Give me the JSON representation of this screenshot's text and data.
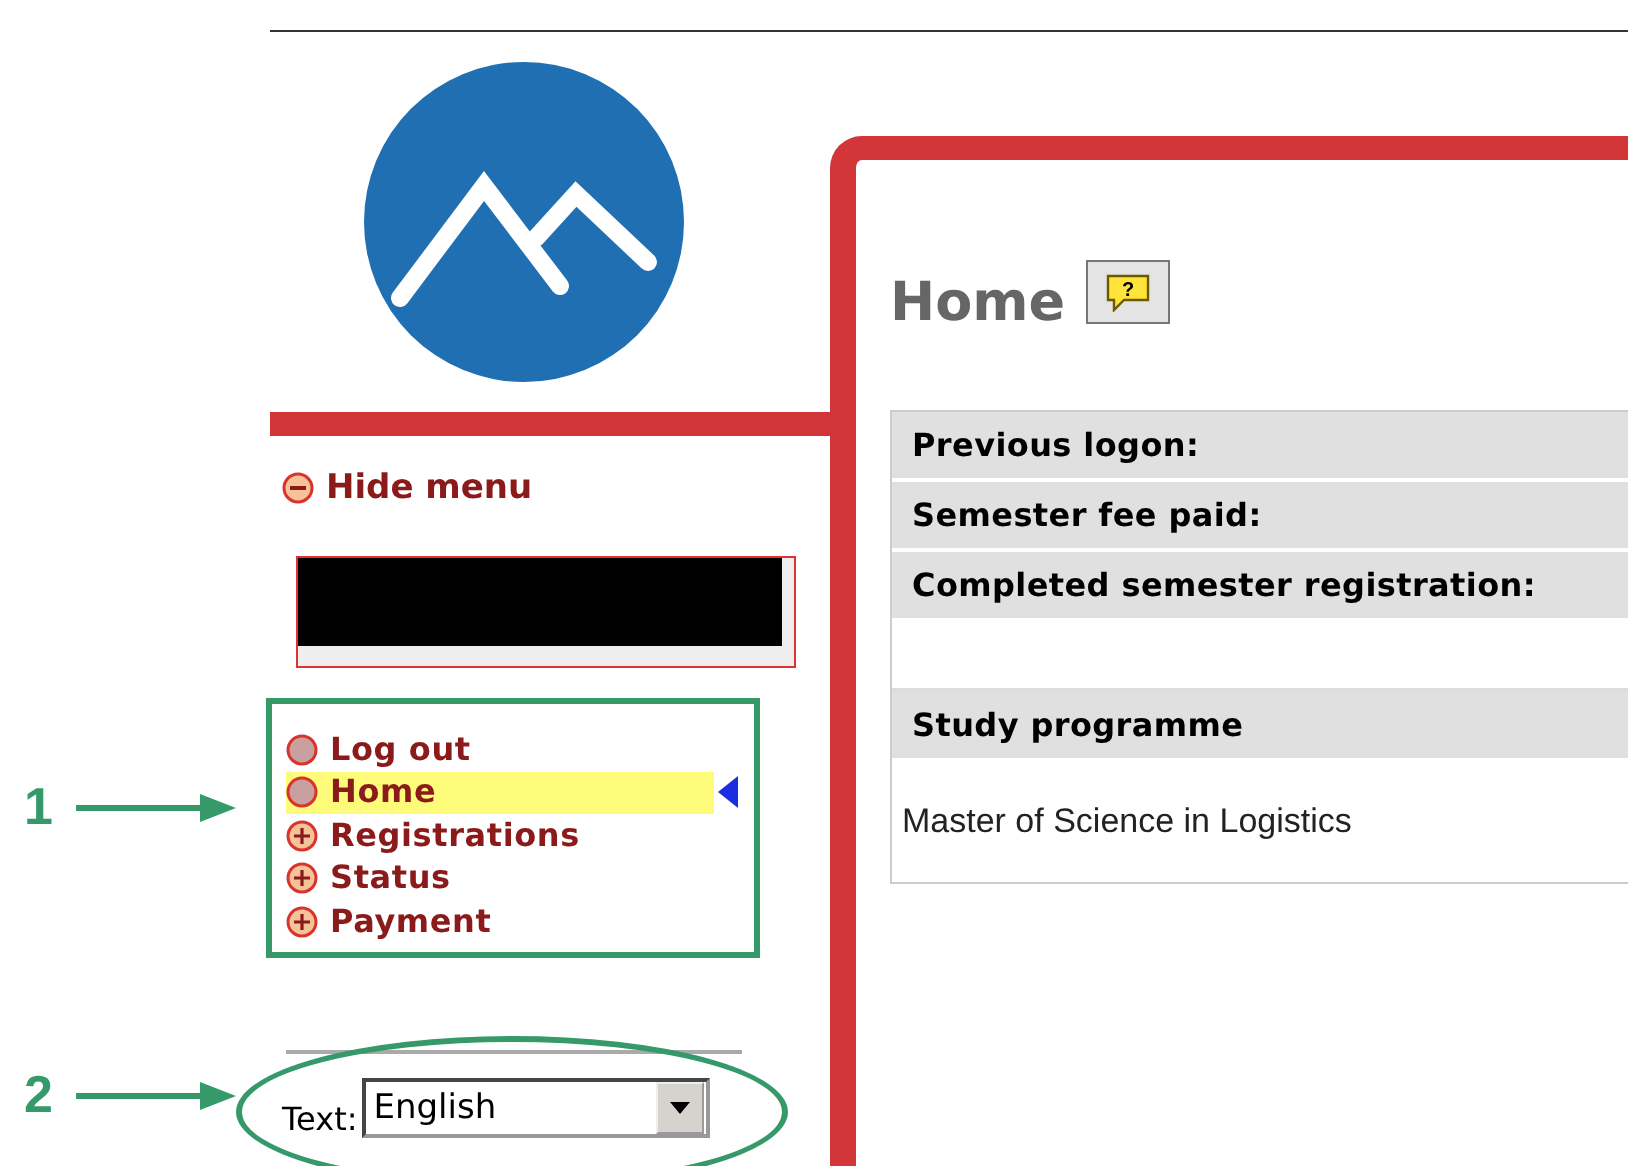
{
  "sidebar": {
    "hide_menu": "Hide menu",
    "menu": [
      {
        "label": "Log out",
        "kind": "plain",
        "selected": false
      },
      {
        "label": "Home",
        "kind": "plain",
        "selected": true
      },
      {
        "label": "Registrations",
        "kind": "expandable",
        "selected": false
      },
      {
        "label": "Status",
        "kind": "expandable",
        "selected": false
      },
      {
        "label": "Payment",
        "kind": "expandable",
        "selected": false
      }
    ],
    "language": {
      "label": "Text:",
      "value": "English"
    }
  },
  "content": {
    "title": "Home",
    "help_mark": "?",
    "rows": [
      {
        "kind": "header",
        "text": "Previous logon:"
      },
      {
        "kind": "header",
        "text": "Semester fee paid:"
      },
      {
        "kind": "header",
        "text": "Completed semester registration:"
      },
      {
        "kind": "blank"
      },
      {
        "kind": "header",
        "text": "Study programme"
      },
      {
        "kind": "value",
        "text": "Master of Science in Logistics"
      }
    ]
  },
  "annotations": [
    {
      "label": "1"
    },
    {
      "label": "2"
    }
  ]
}
